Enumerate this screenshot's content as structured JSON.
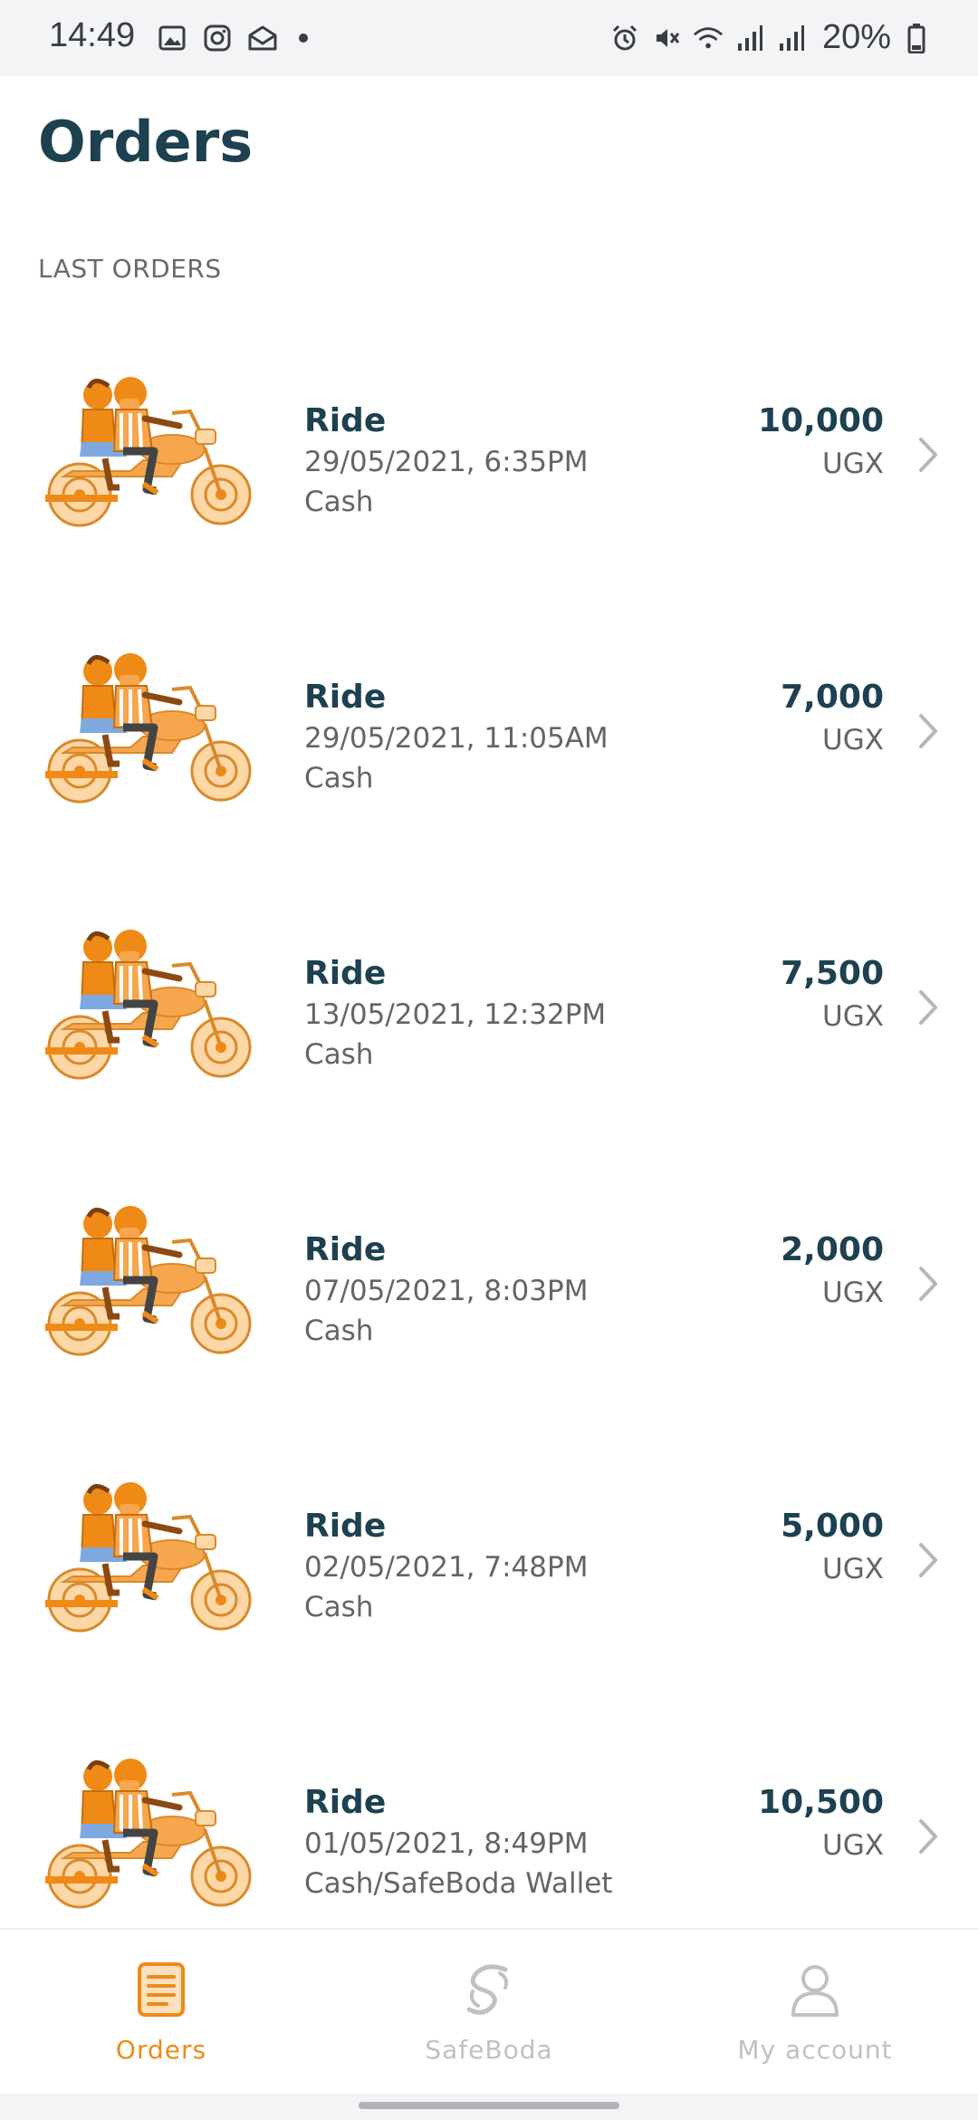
{
  "status_bar": {
    "time": "14:49",
    "left_icons": [
      "gallery-icon",
      "instagram-icon",
      "mail-open-icon",
      "notification-dot"
    ],
    "right_icons": [
      "alarm-icon",
      "vibrate-mute-icon",
      "wifi-icon",
      "signal-icon",
      "signal-icon"
    ],
    "battery_percent": "20%"
  },
  "header": {
    "title": "Orders"
  },
  "section": {
    "label": "LAST ORDERS"
  },
  "orders": [
    {
      "title": "Ride",
      "datetime": "29/05/2021, 6:35PM",
      "payment": "Cash",
      "amount": "10,000",
      "currency": "UGX"
    },
    {
      "title": "Ride",
      "datetime": "29/05/2021, 11:05AM",
      "payment": "Cash",
      "amount": "7,000",
      "currency": "UGX"
    },
    {
      "title": "Ride",
      "datetime": "13/05/2021, 12:32PM",
      "payment": "Cash",
      "amount": "7,500",
      "currency": "UGX"
    },
    {
      "title": "Ride",
      "datetime": "07/05/2021, 8:03PM",
      "payment": "Cash",
      "amount": "2,000",
      "currency": "UGX"
    },
    {
      "title": "Ride",
      "datetime": "02/05/2021, 7:48PM",
      "payment": "Cash",
      "amount": "5,000",
      "currency": "UGX"
    },
    {
      "title": "Ride",
      "datetime": "01/05/2021, 8:49PM",
      "payment": "Cash/SafeBoda Wallet",
      "amount": "10,500",
      "currency": "UGX"
    }
  ],
  "bottom_nav": {
    "items": [
      {
        "label": "Orders",
        "icon": "orders-icon",
        "active": true
      },
      {
        "label": "SafeBoda",
        "icon": "safeboda-logo-icon",
        "active": false
      },
      {
        "label": "My account",
        "icon": "account-icon",
        "active": false
      }
    ]
  },
  "colors": {
    "accent": "#ef8a17",
    "title": "#1d4150",
    "muted": "#626569",
    "inactive": "#bfc1c4"
  }
}
